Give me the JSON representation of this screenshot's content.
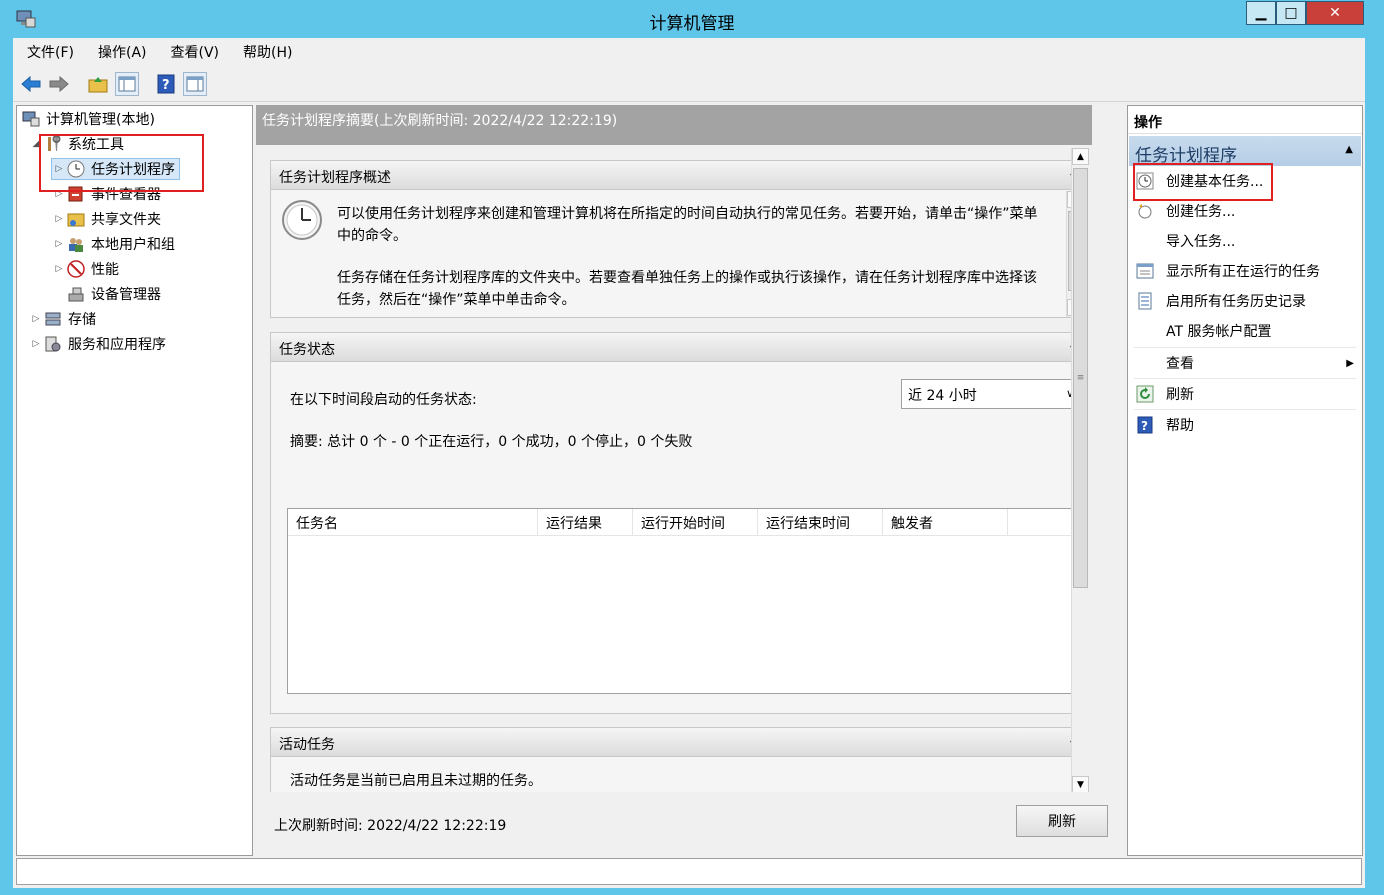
{
  "window": {
    "title": "计算机管理",
    "min_glyph": "▁",
    "max_glyph": "□",
    "close_glyph": "✕"
  },
  "menu": {
    "file": "文件(F)",
    "action": "操作(A)",
    "view": "查看(V)",
    "help": "帮助(H)"
  },
  "tree": {
    "root": "计算机管理(本地)",
    "system_tools": "系统工具",
    "task_scheduler": "任务计划程序",
    "event_viewer": "事件查看器",
    "shared_folders": "共享文件夹",
    "local_users": "本地用户和组",
    "performance": "性能",
    "device_manager": "设备管理器",
    "storage": "存储",
    "services_apps": "服务和应用程序"
  },
  "center": {
    "header": "任务计划程序摘要(上次刷新时间: 2022/4/22 12:22:19)",
    "overview": {
      "title": "任务计划程序概述",
      "para1": "可以使用任务计划程序来创建和管理计算机将在所指定的时间自动执行的常见任务。若要开始，请单击“操作”菜单中的命令。",
      "para2": "任务存储在任务计划程序库的文件夹中。若要查看单独任务上的操作或执行该操作，请在任务计划程序库中选择该任务，然后在“操作”菜单中单击命令。"
    },
    "status": {
      "title": "任务状态",
      "label": "在以下时间段启动的任务状态:",
      "period": "近 24 小时",
      "summary": "摘要: 总计 0 个 - 0 个正在运行，0 个成功，0 个停止，0 个失败",
      "columns": [
        "任务名",
        "运行结果",
        "运行开始时间",
        "运行结束时间",
        "触发者"
      ]
    },
    "active": {
      "title": "活动任务",
      "text": "活动任务是当前已启用且未过期的任务。"
    },
    "footer": {
      "last_refresh": "上次刷新时间: 2022/4/22 12:22:19",
      "refresh_button": "刷新"
    }
  },
  "actions": {
    "header": "操作",
    "group": "任务计划程序",
    "items": {
      "create_basic": "创建基本任务...",
      "create": "创建任务...",
      "import": "导入任务...",
      "show_running": "显示所有正在运行的任务",
      "enable_history": "启用所有任务历史记录",
      "at_config": "AT 服务帐户配置",
      "view": "查看",
      "refresh": "刷新",
      "help": "帮助"
    }
  },
  "colors": {
    "titlebar": "#5fc6ea",
    "highlight": "#e02020",
    "close": "#c9403a"
  }
}
